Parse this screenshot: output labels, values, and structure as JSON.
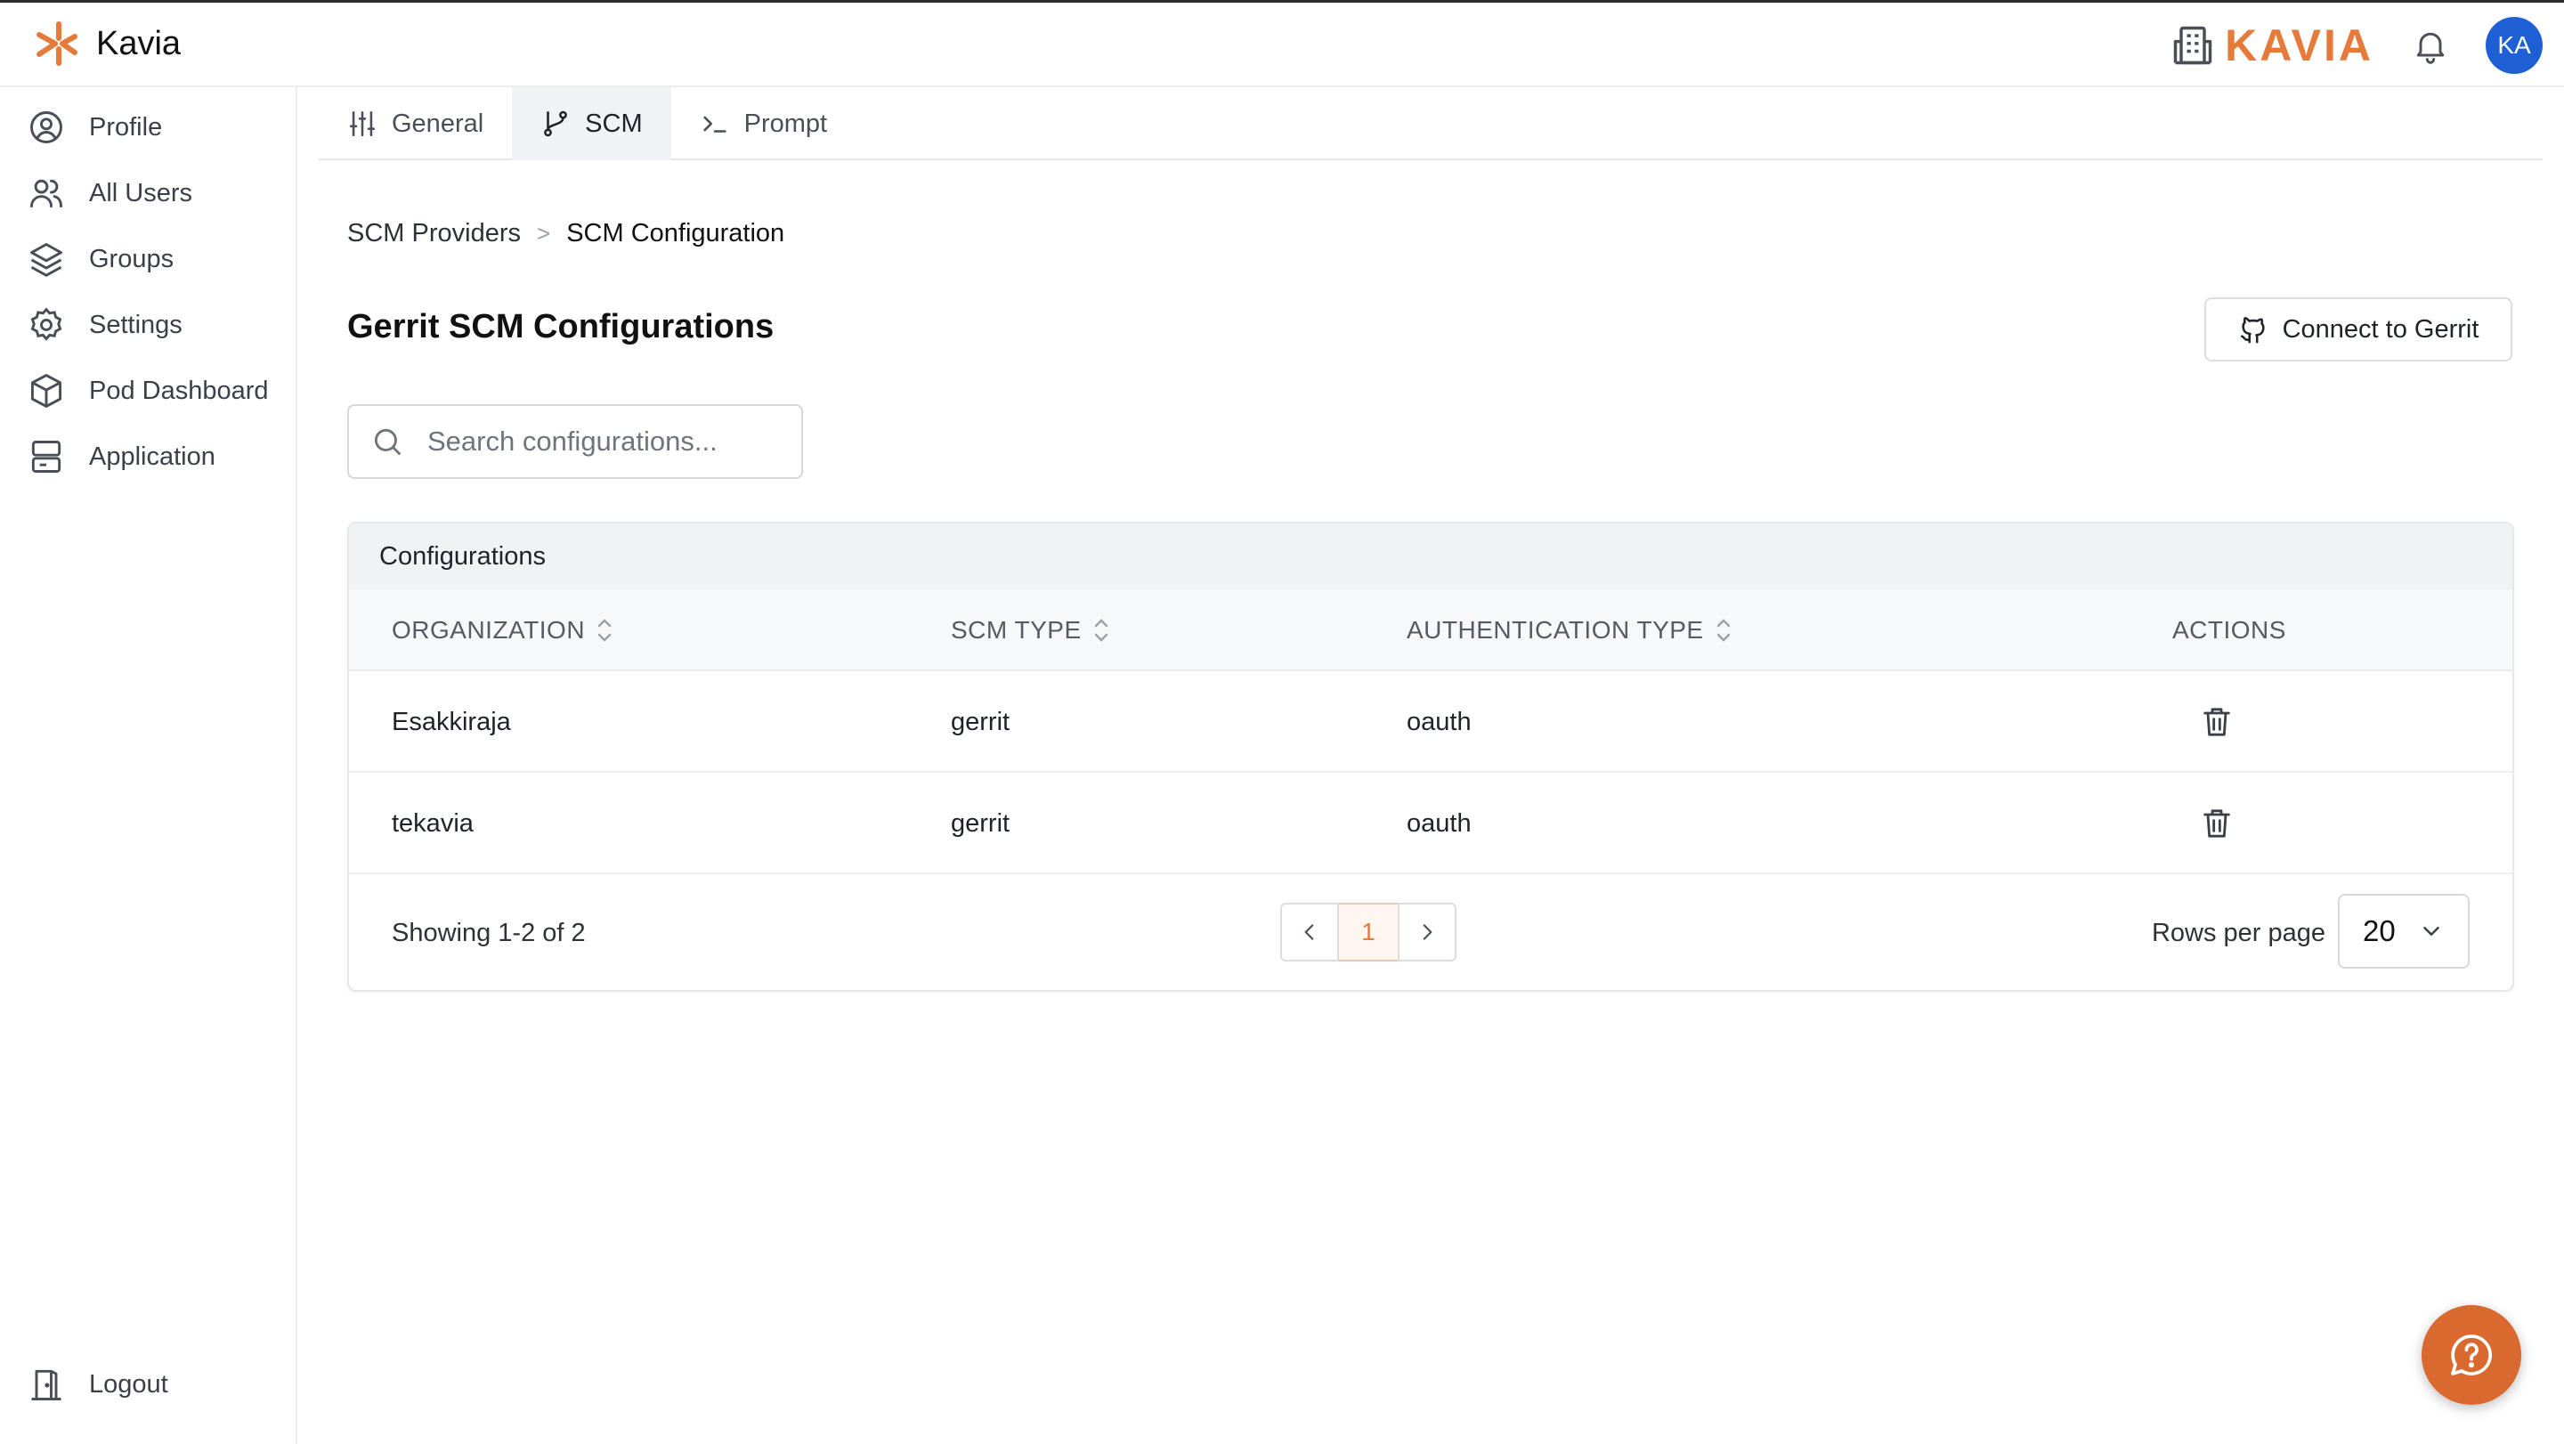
{
  "app": {
    "name": "Kavia"
  },
  "header": {
    "org_name": "KAVIA",
    "avatar_initials": "KA"
  },
  "colors": {
    "accent": "#e57a3a",
    "avatar": "#1f5fd6",
    "fab": "#d9692f"
  },
  "sidebar": {
    "items": [
      {
        "label": "Profile",
        "icon": "user-circle-icon"
      },
      {
        "label": "All Users",
        "icon": "users-icon"
      },
      {
        "label": "Groups",
        "icon": "layers-icon"
      },
      {
        "label": "Settings",
        "icon": "gear-icon"
      },
      {
        "label": "Pod Dashboard",
        "icon": "box-icon"
      },
      {
        "label": "Application",
        "icon": "server-icon"
      }
    ],
    "logout_label": "Logout"
  },
  "tabs": [
    {
      "label": "General",
      "icon": "sliders-icon",
      "active": false
    },
    {
      "label": "SCM",
      "icon": "git-branch-icon",
      "active": true
    },
    {
      "label": "Prompt",
      "icon": "terminal-icon",
      "active": false
    }
  ],
  "breadcrumb": {
    "items": [
      "SCM Providers",
      "SCM Configuration"
    ],
    "separator": ">"
  },
  "page": {
    "title": "Gerrit SCM Configurations",
    "connect_button": "Connect to Gerrit",
    "search_placeholder": "Search configurations..."
  },
  "table": {
    "card_title": "Configurations",
    "columns": [
      "ORGANIZATION",
      "SCM TYPE",
      "AUTHENTICATION TYPE",
      "ACTIONS"
    ],
    "rows": [
      {
        "organization": "Esakkiraja",
        "scm_type": "gerrit",
        "auth_type": "oauth"
      },
      {
        "organization": "tekavia",
        "scm_type": "gerrit",
        "auth_type": "oauth"
      }
    ],
    "showing": "Showing 1-2 of 2",
    "current_page": "1",
    "rows_per_page_label": "Rows per page",
    "rows_per_page": "20"
  }
}
